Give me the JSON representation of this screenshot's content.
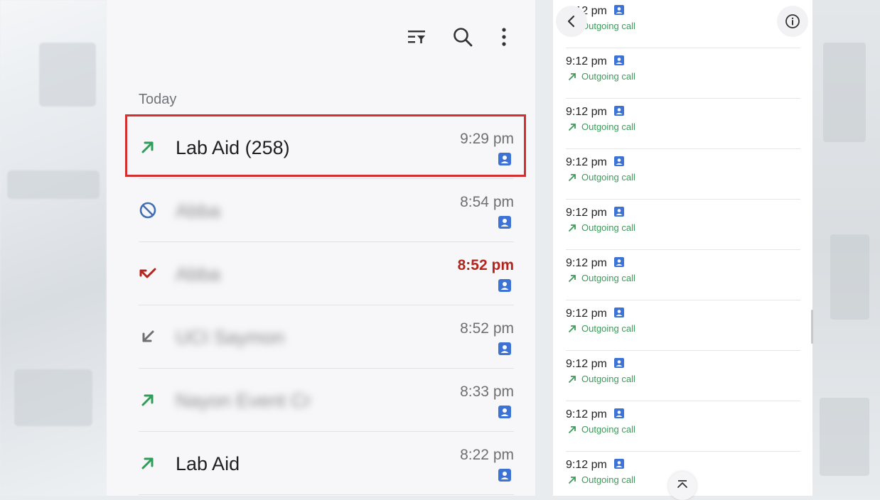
{
  "section": {
    "today_label": "Today"
  },
  "calls": [
    {
      "name": "Lab Aid (258)",
      "time": "9:29 pm",
      "direction": "outgoing",
      "blurred": false,
      "missed": false,
      "dir_icon": "outgoing-arrow-icon"
    },
    {
      "name": "Abba",
      "time": "8:54 pm",
      "direction": "blocked",
      "blurred": true,
      "missed": false,
      "dir_icon": "blocked-icon"
    },
    {
      "name": "Abba",
      "time": "8:52 pm",
      "direction": "missed",
      "blurred": true,
      "missed": true,
      "dir_icon": "missed-call-icon"
    },
    {
      "name": "UCI Saymon",
      "time": "8:52 pm",
      "direction": "incoming",
      "blurred": true,
      "missed": false,
      "dir_icon": "incoming-arrow-icon"
    },
    {
      "name": "Nayon Event Cr",
      "time": "8:33 pm",
      "direction": "outgoing",
      "blurred": true,
      "missed": false,
      "dir_icon": "outgoing-arrow-icon"
    },
    {
      "name": "Lab Aid",
      "time": "8:22 pm",
      "direction": "outgoing",
      "blurred": false,
      "missed": false,
      "dir_icon": "outgoing-arrow-icon"
    }
  ],
  "details": {
    "first_time": "9:12 pm",
    "entries": [
      {
        "time": "9:12 pm",
        "type": "Outgoing call"
      },
      {
        "time": "9:12 pm",
        "type": "Outgoing call"
      },
      {
        "time": "9:12 pm",
        "type": "Outgoing call"
      },
      {
        "time": "9:12 pm",
        "type": "Outgoing call"
      },
      {
        "time": "9:12 pm",
        "type": "Outgoing call"
      },
      {
        "time": "9:12 pm",
        "type": "Outgoing call"
      },
      {
        "time": "9:12 pm",
        "type": "Outgoing call"
      },
      {
        "time": "9:12 pm",
        "type": "Outgoing call"
      },
      {
        "time": "9:12 pm",
        "type": "Outgoing call"
      },
      {
        "time": "9:12 pm",
        "type": "Outgoing call"
      }
    ]
  },
  "icons": {
    "filter": "filter-icon",
    "search": "search-icon",
    "more": "more-vert-icon",
    "back": "chevron-left-icon",
    "info": "info-icon",
    "scroll_top": "chevron-up-icon",
    "contact_badge": "contact-badge-icon"
  },
  "colors": {
    "outgoing": "#2e9d58",
    "missed": "#b3261e",
    "blocked": "#3f6fb5",
    "incoming": "#707070",
    "badge": "#3e73d6",
    "highlight": "#d32f2f"
  }
}
